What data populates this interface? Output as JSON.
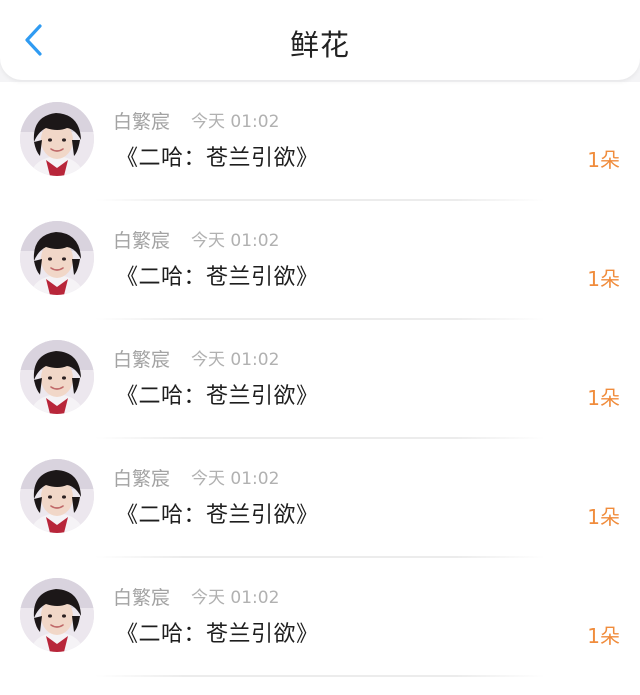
{
  "header": {
    "title": "鲜花",
    "back_icon": "chevron-left-icon",
    "accent_color": "#2f9bf2"
  },
  "flower_list": {
    "items": [
      {
        "sender": "白繁宸",
        "time": "今天 01:02",
        "book": "《二哈：苍兰引欲》",
        "count": "1朵",
        "avatar_icon": "user-avatar"
      },
      {
        "sender": "白繁宸",
        "time": "今天 01:02",
        "book": "《二哈：苍兰引欲》",
        "count": "1朵",
        "avatar_icon": "user-avatar"
      },
      {
        "sender": "白繁宸",
        "time": "今天 01:02",
        "book": "《二哈：苍兰引欲》",
        "count": "1朵",
        "avatar_icon": "user-avatar"
      },
      {
        "sender": "白繁宸",
        "time": "今天 01:02",
        "book": "《二哈：苍兰引欲》",
        "count": "1朵",
        "avatar_icon": "user-avatar"
      },
      {
        "sender": "白繁宸",
        "time": "今天 01:02",
        "book": "《二哈：苍兰引欲》",
        "count": "1朵",
        "avatar_icon": "user-avatar"
      }
    ]
  },
  "colors": {
    "count_color": "#f08c3c",
    "sender_color": "#a3a3a3",
    "book_color": "#1e1e1e"
  }
}
